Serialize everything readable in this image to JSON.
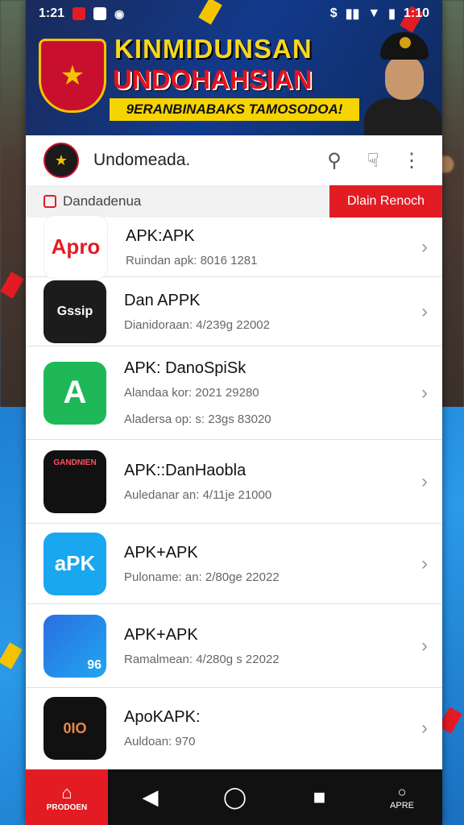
{
  "status": {
    "time_left": "1:21",
    "time_right": "1:10"
  },
  "banner": {
    "title_line1": "KINMIDUNSAN",
    "title_line2": "UNDOHAHSIAN",
    "subtitle": "9ERANBINABAKS TAMOSODOA!"
  },
  "appbar": {
    "title": "Undomeada.",
    "search_icon": "search-icon",
    "touch_icon": "touch-icon",
    "menu_icon": "more-vert-icon"
  },
  "subbar": {
    "category": "Dandadenua",
    "button": "Dlain Renoch"
  },
  "apps": [
    {
      "title": "APK:APK",
      "meta": "Ruindan apk: 8016 1281",
      "icon_text": "Apro"
    },
    {
      "title": "Dan APPK",
      "meta": "Dianidoraan: 4/239g 22002",
      "icon_text": "Gssip"
    },
    {
      "title": "APK: DanoSpiSk",
      "meta": "Alandaa kor: 2021 29280",
      "meta2": "Aladersa op: s: 23gs 83020",
      "icon_text": "A"
    },
    {
      "title": "APK::DanHaobla",
      "meta": "Auledanar an: 4/11je 21000",
      "icon_text": "GANDNIEN"
    },
    {
      "title": "APK+APK",
      "meta": "Puloname: an: 2/80ge 22022",
      "icon_text": "aPK"
    },
    {
      "title": "APK+APK",
      "meta": "Ramalmean: 4/280g s 22022",
      "icon_text": "96"
    },
    {
      "title": "ApoKAPK:",
      "meta": "Auldoan: 970",
      "icon_text": "0IO"
    }
  ],
  "navbar": {
    "home_label": "PRODOEN",
    "apps_label": "APRE"
  },
  "colors": {
    "accent": "#e31c24",
    "banner_yellow": "#f5d400"
  }
}
